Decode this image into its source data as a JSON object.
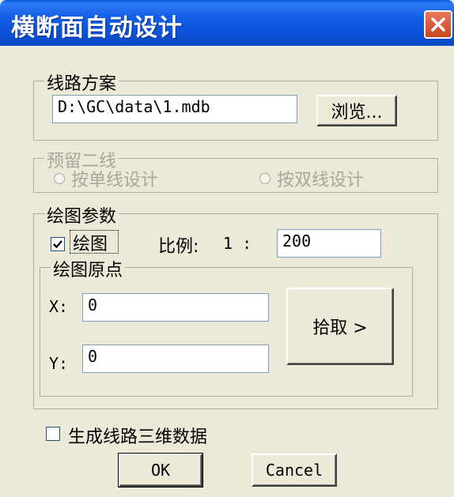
{
  "window": {
    "title": "横断面自动设计"
  },
  "route_scheme": {
    "legend": "线路方案",
    "path_value": "D:\\GC\\data\\1.mdb",
    "browse_label": "浏览..."
  },
  "reserve_second_line": {
    "legend": "预留二线",
    "option_single": "按单线设计",
    "option_double": "按双线设计",
    "enabled": false
  },
  "drawing_params": {
    "legend": "绘图参数",
    "draw_checkbox_label": "绘图",
    "draw_checked": true,
    "scale_label": "比例:",
    "scale_prefix": "1 :",
    "scale_value": "200",
    "origin": {
      "legend": "绘图原点",
      "x_label": "X:",
      "x_value": "0",
      "y_label": "Y:",
      "y_value": "0",
      "pick_label": "拾取 >"
    }
  },
  "generate_3d": {
    "label": "生成线路三维数据",
    "checked": false
  },
  "buttons": {
    "ok": "OK",
    "cancel": "Cancel"
  },
  "colors": {
    "titlebar": "#0a58e6",
    "dialog_bg": "#ece9d8",
    "close_btn": "#c9451f"
  },
  "icons": {
    "close": "close-icon",
    "checkmark": "checkmark-icon"
  }
}
